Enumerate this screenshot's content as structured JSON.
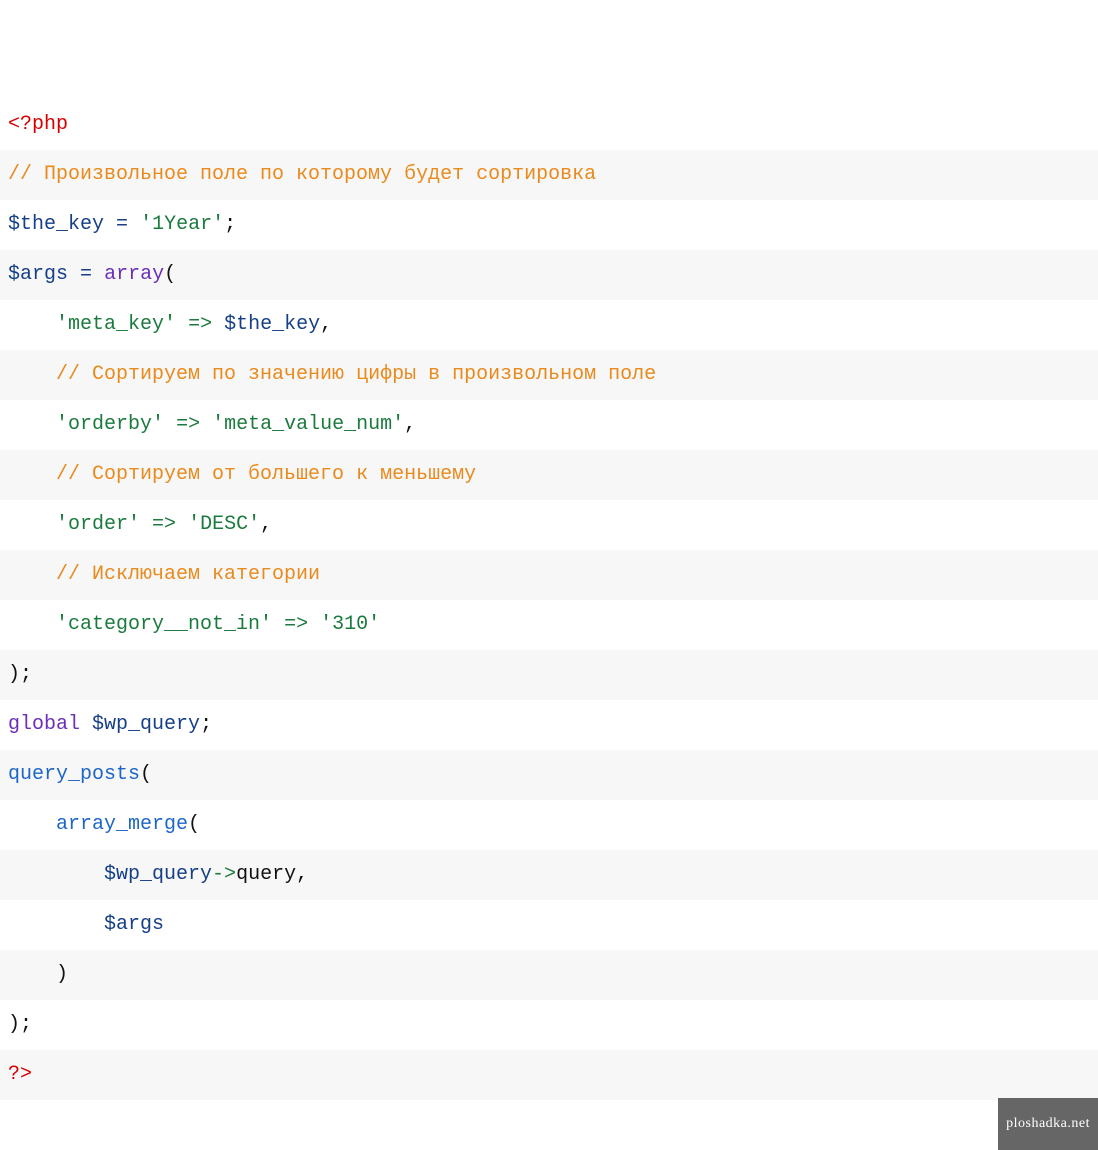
{
  "code": {
    "lines": [
      [
        {
          "cls": "php-tag",
          "text": "<?php"
        }
      ],
      [
        {
          "cls": "comment",
          "text": "// Произвольное поле по которому будет сортировка"
        }
      ],
      [
        {
          "cls": "var",
          "text": "$the_key"
        },
        {
          "cls": "txt",
          "text": " "
        },
        {
          "cls": "op",
          "text": "="
        },
        {
          "cls": "txt",
          "text": " "
        },
        {
          "cls": "str",
          "text": "'1Year'"
        },
        {
          "cls": "txt",
          "text": ";"
        }
      ],
      [
        {
          "cls": "var",
          "text": "$args"
        },
        {
          "cls": "txt",
          "text": " "
        },
        {
          "cls": "op",
          "text": "="
        },
        {
          "cls": "txt",
          "text": " "
        },
        {
          "cls": "kw",
          "text": "array"
        },
        {
          "cls": "txt",
          "text": "("
        }
      ],
      [
        {
          "cls": "txt",
          "text": "    "
        },
        {
          "cls": "str",
          "text": "'meta_key'"
        },
        {
          "cls": "txt",
          "text": " "
        },
        {
          "cls": "arrow",
          "text": "=>"
        },
        {
          "cls": "txt",
          "text": " "
        },
        {
          "cls": "var",
          "text": "$the_key"
        },
        {
          "cls": "txt",
          "text": ","
        }
      ],
      [
        {
          "cls": "txt",
          "text": "    "
        },
        {
          "cls": "comment",
          "text": "// Сортируем по значению цифры в произвольном поле"
        }
      ],
      [
        {
          "cls": "txt",
          "text": "    "
        },
        {
          "cls": "str",
          "text": "'orderby'"
        },
        {
          "cls": "txt",
          "text": " "
        },
        {
          "cls": "arrow",
          "text": "=>"
        },
        {
          "cls": "txt",
          "text": " "
        },
        {
          "cls": "str",
          "text": "'meta_value_num'"
        },
        {
          "cls": "txt",
          "text": ","
        }
      ],
      [
        {
          "cls": "txt",
          "text": "    "
        },
        {
          "cls": "comment",
          "text": "// Сортируем от большего к меньшему"
        }
      ],
      [
        {
          "cls": "txt",
          "text": "    "
        },
        {
          "cls": "str",
          "text": "'order'"
        },
        {
          "cls": "txt",
          "text": " "
        },
        {
          "cls": "arrow",
          "text": "=>"
        },
        {
          "cls": "txt",
          "text": " "
        },
        {
          "cls": "str",
          "text": "'DESC'"
        },
        {
          "cls": "txt",
          "text": ","
        }
      ],
      [
        {
          "cls": "txt",
          "text": "    "
        },
        {
          "cls": "comment",
          "text": "// Исключаем категории"
        }
      ],
      [
        {
          "cls": "txt",
          "text": "    "
        },
        {
          "cls": "str",
          "text": "'category__not_in'"
        },
        {
          "cls": "txt",
          "text": " "
        },
        {
          "cls": "arrow",
          "text": "=>"
        },
        {
          "cls": "txt",
          "text": " "
        },
        {
          "cls": "str",
          "text": "'310'"
        }
      ],
      [
        {
          "cls": "txt",
          "text": ");"
        }
      ],
      [
        {
          "cls": "kw",
          "text": "global"
        },
        {
          "cls": "txt",
          "text": " "
        },
        {
          "cls": "var",
          "text": "$wp_query"
        },
        {
          "cls": "txt",
          "text": ";"
        }
      ],
      [
        {
          "cls": "fn",
          "text": "query_posts"
        },
        {
          "cls": "txt",
          "text": "("
        }
      ],
      [
        {
          "cls": "txt",
          "text": "    "
        },
        {
          "cls": "fn",
          "text": "array_merge"
        },
        {
          "cls": "txt",
          "text": "("
        }
      ],
      [
        {
          "cls": "txt",
          "text": "        "
        },
        {
          "cls": "var",
          "text": "$wp_query"
        },
        {
          "cls": "arrow",
          "text": "->"
        },
        {
          "cls": "txt",
          "text": "query,"
        }
      ],
      [
        {
          "cls": "txt",
          "text": "        "
        },
        {
          "cls": "var",
          "text": "$args"
        }
      ],
      [
        {
          "cls": "txt",
          "text": "    )"
        }
      ],
      [
        {
          "cls": "txt",
          "text": ");"
        }
      ],
      [
        {
          "cls": "php-tag",
          "text": "?>"
        }
      ]
    ]
  },
  "watermark": "ploshadka.net"
}
